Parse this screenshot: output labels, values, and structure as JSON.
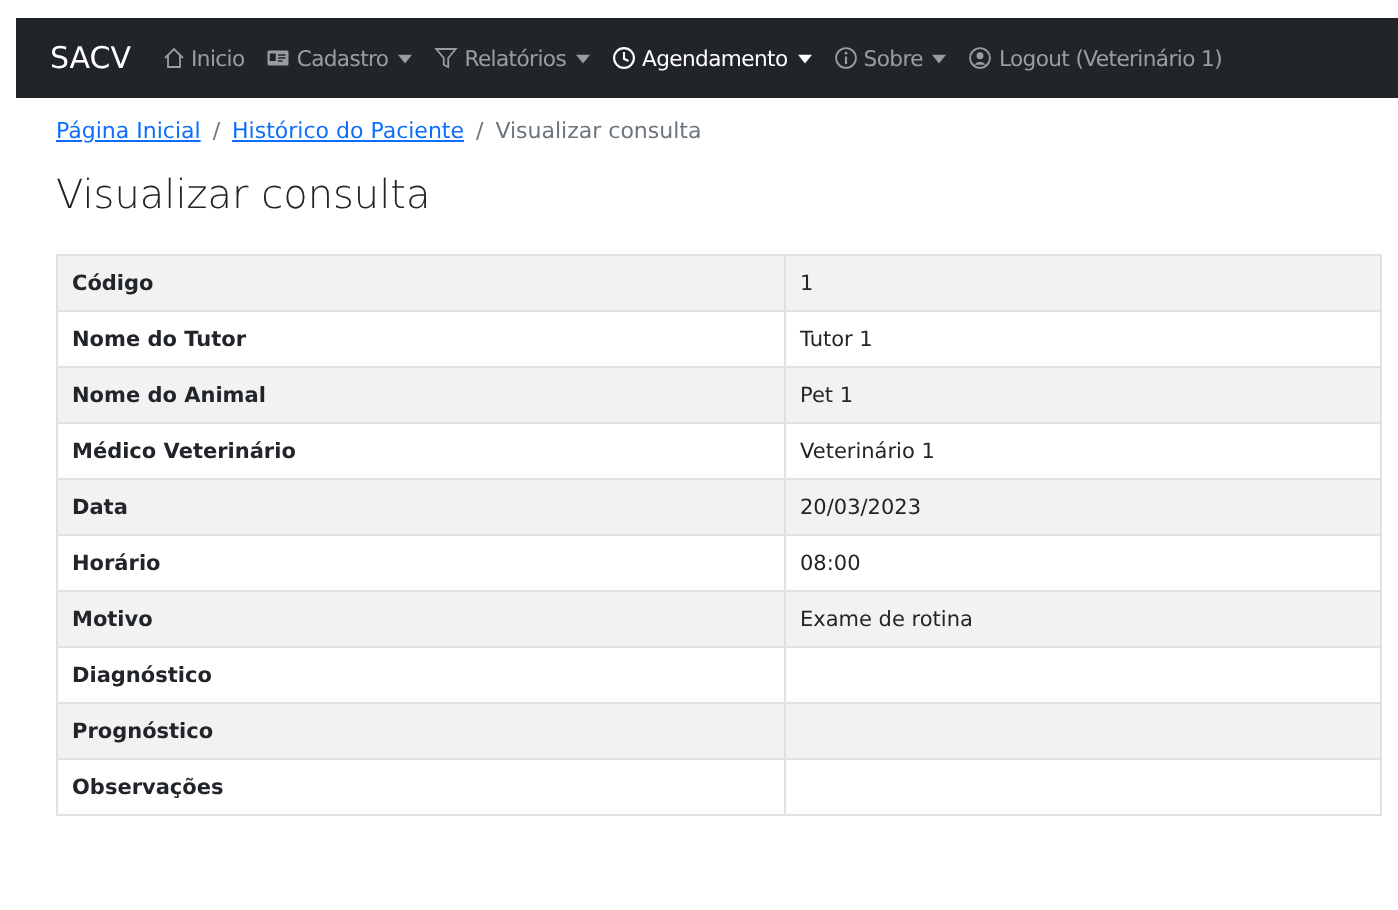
{
  "navbar": {
    "brand": "SACV",
    "items": [
      {
        "label": "Inicio",
        "dropdown": false,
        "selected": false
      },
      {
        "label": "Cadastro",
        "dropdown": true,
        "selected": false
      },
      {
        "label": "Relatórios",
        "dropdown": true,
        "selected": false
      },
      {
        "label": "Agendamento",
        "dropdown": true,
        "selected": true
      },
      {
        "label": "Sobre",
        "dropdown": true,
        "selected": false
      },
      {
        "label": "Logout (Veterinário 1)",
        "dropdown": false,
        "selected": false
      }
    ]
  },
  "breadcrumb": [
    {
      "label": "Página Inicial",
      "link": true
    },
    {
      "separator": "/",
      "label": "Histórico do Paciente",
      "link": true
    },
    {
      "separator": "/",
      "label": "Visualizar consulta",
      "link": false
    }
  ],
  "title": "Visualizar consulta",
  "table": {
    "rows": [
      {
        "label": "Código",
        "value": "1"
      },
      {
        "label": "Nome do Tutor",
        "value": "Tutor 1"
      },
      {
        "label": "Nome do Animal",
        "value": "Pet 1"
      },
      {
        "label": "Médico Veterinário",
        "value": "Veterinário 1"
      },
      {
        "label": "Data",
        "value": "20/03/2023"
      },
      {
        "label": "Horário",
        "value": "08:00"
      },
      {
        "label": "Motivo",
        "value": "Exame de rotina"
      },
      {
        "label": "Diagnóstico"
      },
      {
        "label": "Prognóstico"
      },
      {
        "label": "Observações"
      }
    ]
  }
}
